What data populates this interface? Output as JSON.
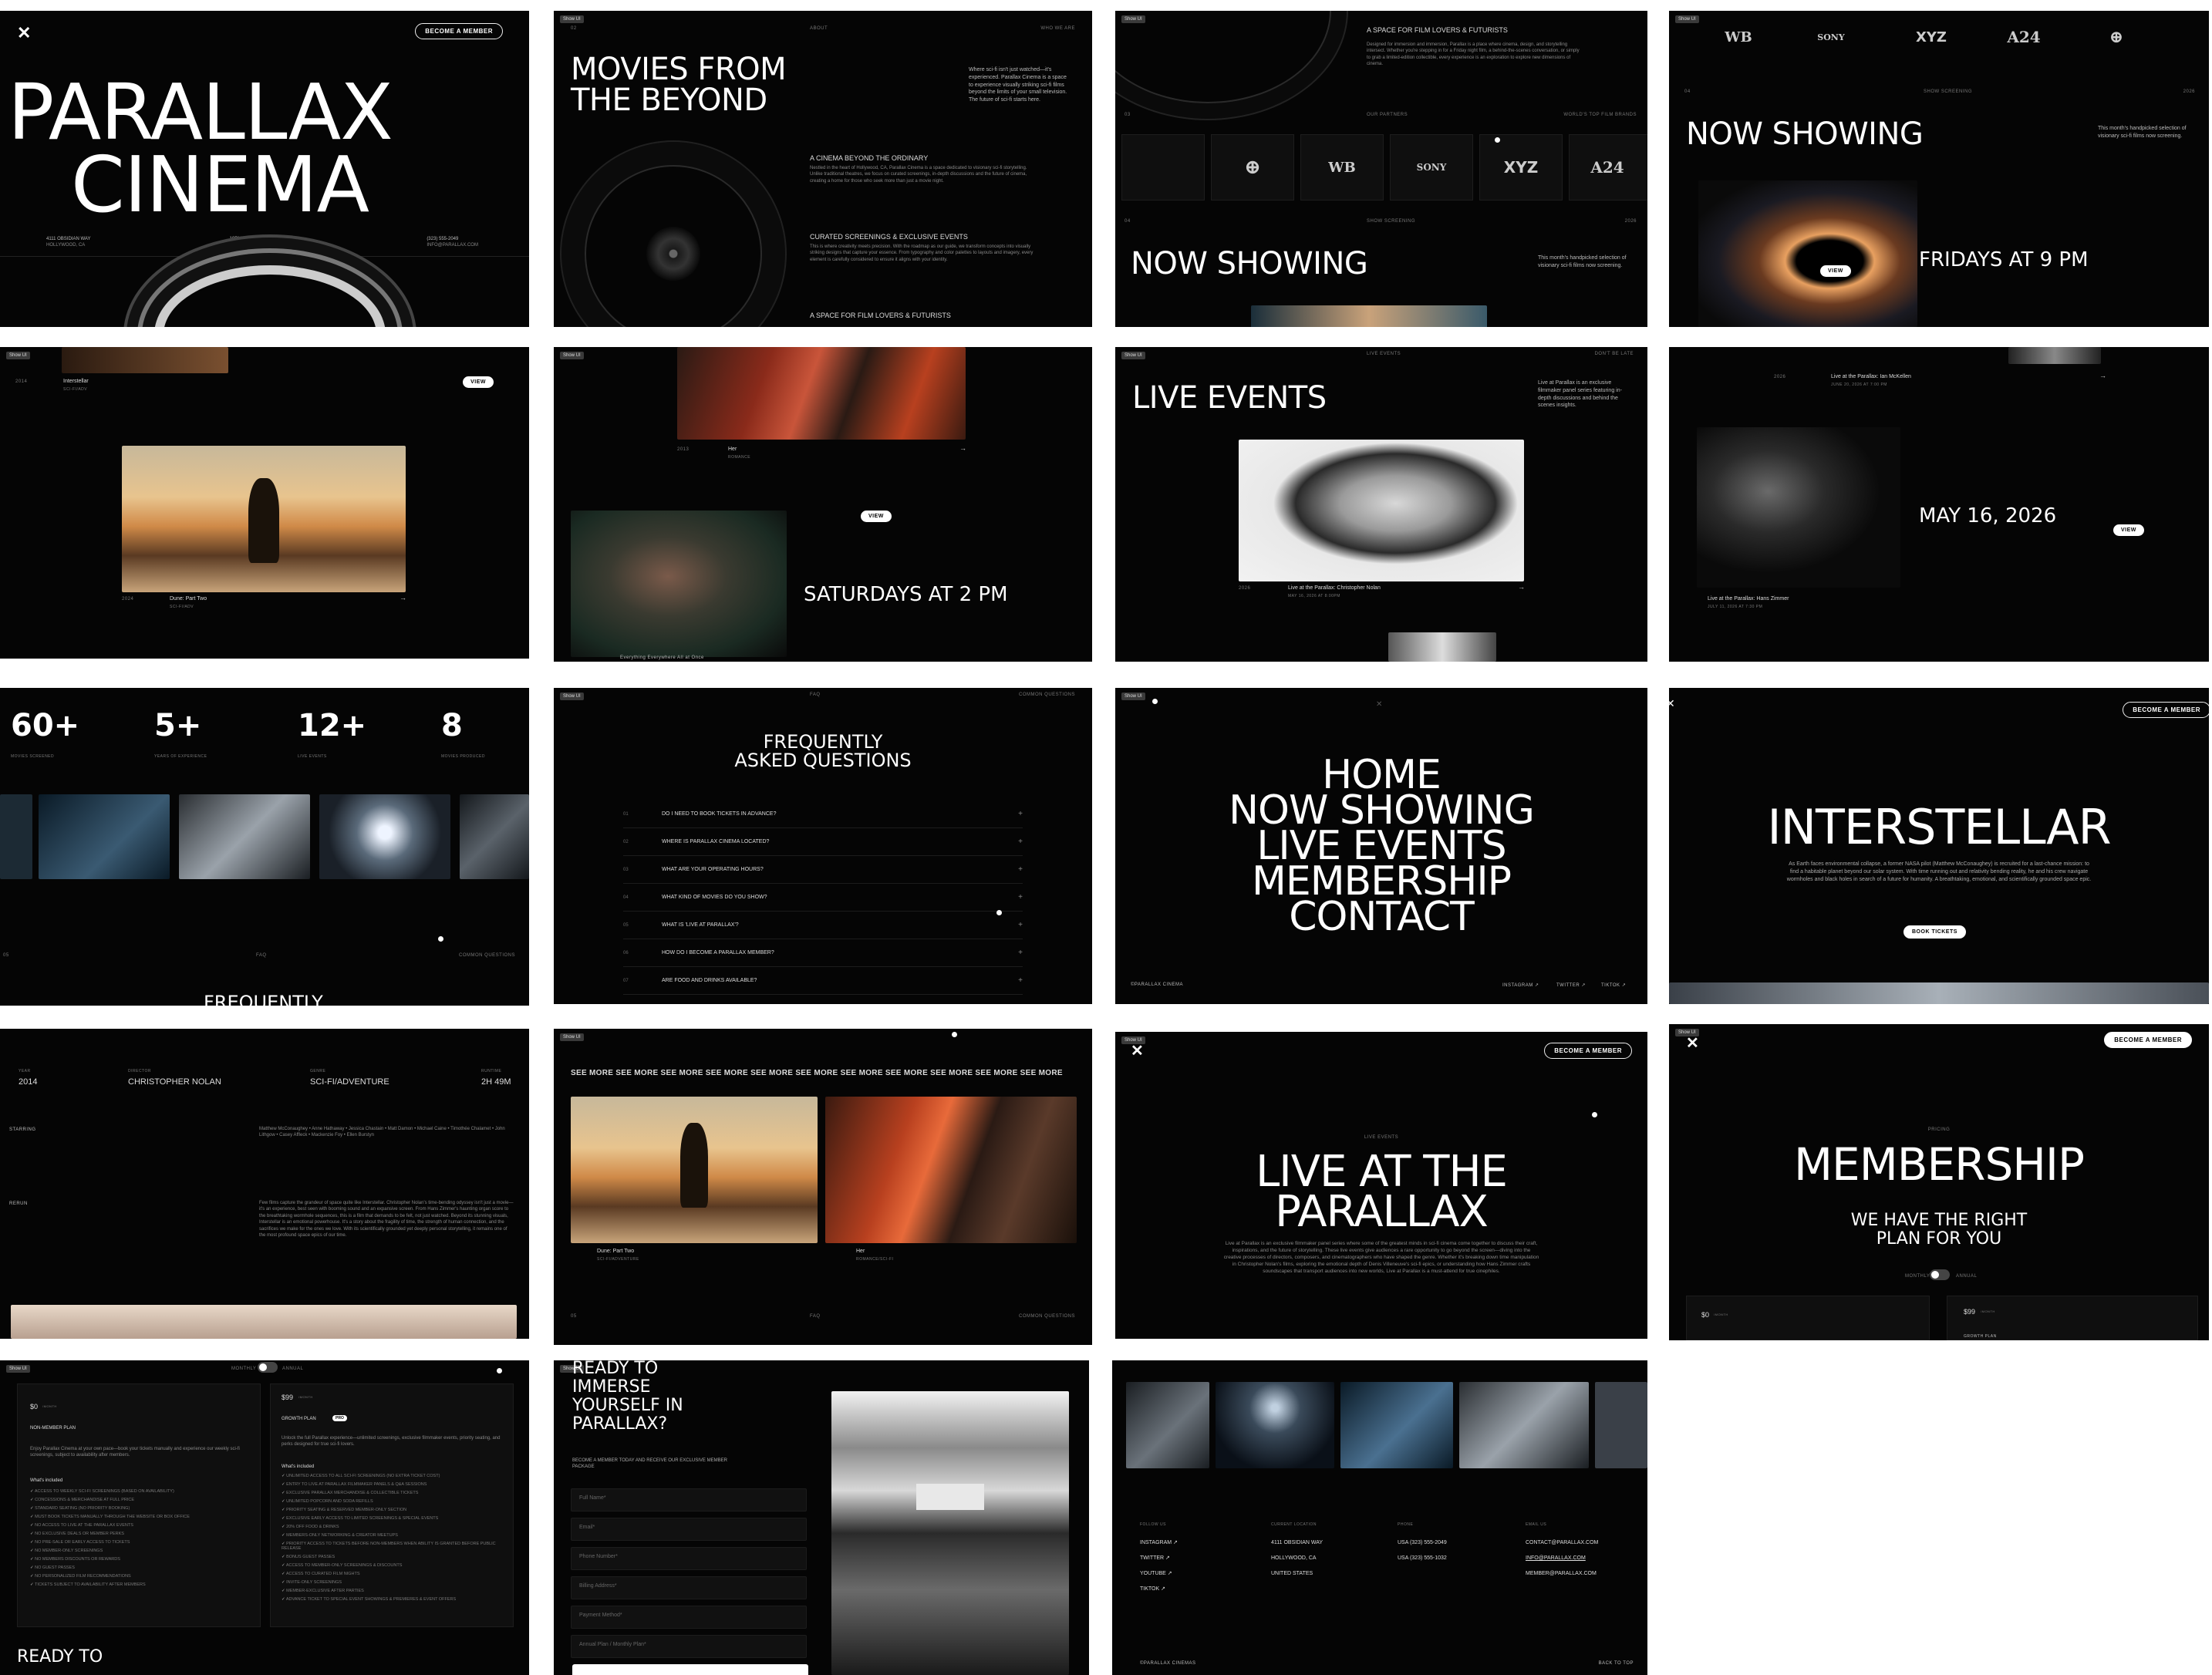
{
  "tag": "Show UI",
  "p1": {
    "cta": "BECOME A MEMBER",
    "title1": "PARALLAX",
    "title2": "CINEMA",
    "info": [
      {
        "a": "4111 OBSIDIAN WAY",
        "b": "HOLLYWOOD, CA"
      },
      {
        "a": "10PM TO 2AM",
        "b": "THURSDAY TO SATURDAY"
      },
      {
        "a": "(323) 555-2049",
        "b": "INFO@PARALLAX.COM"
      }
    ]
  },
  "p2": {
    "num": "02",
    "about": "ABOUT",
    "who": "WHO WE ARE",
    "title": "MOVIES FROM THE BEYOND",
    "intro": "Where sci-fi isn't just watched—it's experienced. Parallax Cinema is a space to experience visually striking sci-fi films beyond the limits of your small television. The future of sci-fi starts here.",
    "s1h": "A CINEMA BEYOND THE ORDINARY",
    "s1": "Nestled in the heart of Hollywood, CA, Parallax Cinema is a space dedicated to visionary sci-fi storytelling. Unlike traditional theatres, we focus on curated screenings, in-depth discussions and the future of cinema, creating a home for those who seek more than just a movie night.",
    "s2h": "CURATED SCREENINGS & EXCLUSIVE EVENTS",
    "s2": "This is where creativity meets precision. With the roadmap as our guide, we transform concepts into visually striking designs that capture your essence. From typography and color palettes to layouts and imagery, every element is carefully considered to ensure it aligns with your identity.",
    "s3h": "A SPACE FOR FILM LOVERS & FUTURISTS"
  },
  "p3": {
    "head": "A SPACE FOR FILM LOVERS & FUTURISTS",
    "body": "Designed for immersion and immersion, Parallax is a place where cinema, design, and storytelling intersect. Whether you're stepping in for a Friday night film, a behind-the-scenes conversation, or simply to grab a limited-edition collectible, every experience is an exploration to explore new dimensions of cinema.",
    "num": "03",
    "partners": "OUR PARTNERS",
    "brands": "WORLD'S TOP FILM BRANDS",
    "logos": [
      "⊕",
      "WB",
      "SONY",
      "XYZ",
      "A24"
    ],
    "num2": "04",
    "showing": "SHOW SCREENING",
    "year": "2026",
    "title": "NOW SHOWING",
    "desc": "This month's handpicked selection of visionary sci-fi films now screening."
  },
  "p4": {
    "logos": [
      "WB",
      "SONY",
      "XYZ",
      "A24",
      "⊕"
    ],
    "num": "04",
    "showing": "SHOW SCREENING",
    "year": "2026",
    "title": "NOW SHOWING",
    "desc": "This month's handpicked selection of visionary sci-fi films now screening.",
    "view": "VIEW",
    "time": "FRIDAYS AT 9 PM"
  },
  "p5": {
    "year": "2014",
    "film": "Interstellar",
    "sub": "SCI-FI/ADV",
    "view": "VIEW",
    "year2": "2024",
    "film2": "Dune: Part Two",
    "sub2": "SCI-FI/ADV"
  },
  "p6": {
    "year": "2013",
    "film": "Her",
    "sub": "ROMANCE",
    "view": "VIEW",
    "time": "SATURDAYS AT 2 PM",
    "film2": "Everything Everywhere All at Once"
  },
  "p7": {
    "title": "LIVE EVENTS",
    "label": "LIVE EVENTS",
    "label2": "DON'T BE LATE",
    "desc": "Live at Parallax is an exclusive filmmaker panel series featuring in-depth discussions and behind the scenes insights.",
    "year": "2026",
    "event": "Live at the Parallax: Christopher Nolan",
    "date": "MAY 16, 2026 AT 8:00PM"
  },
  "p8": {
    "year": "2026",
    "event": "Live at the Parallax: Ian McKellen",
    "edate": "JUNE 20, 2026 AT 7:00 PM",
    "date": "MAY 16, 2026",
    "view": "VIEW",
    "event2": "Live at the Parallax: Hans Zimmer",
    "edate2": "JULY 11, 2026 AT 7:30 PM"
  },
  "p9": {
    "stats": [
      {
        "v": "60+",
        "l": "MOVIES SCREENED"
      },
      {
        "v": "5+",
        "l": "YEARS OF EXPERIENCE"
      },
      {
        "v": "12+",
        "l": "LIVE EVENTS"
      },
      {
        "v": "8",
        "l": "MOVIES PRODUCED"
      }
    ],
    "num": "05",
    "faq": "FAQ",
    "cq": "COMMON QUESTIONS",
    "title": "FREQUENTLY"
  },
  "p10": {
    "faq": "FAQ",
    "cq": "COMMON QUESTIONS",
    "title1": "FREQUENTLY",
    "title2": "ASKED QUESTIONS",
    "items": [
      {
        "n": "01",
        "q": "DO I NEED TO BOOK TICKETS IN ADVANCE?"
      },
      {
        "n": "02",
        "q": "WHERE IS PARALLAX CINEMA LOCATED?"
      },
      {
        "n": "03",
        "q": "WHAT ARE YOUR OPERATING HOURS?"
      },
      {
        "n": "04",
        "q": "WHAT KIND OF MOVIES DO YOU SHOW?"
      },
      {
        "n": "05",
        "q": "WHAT IS 'LIVE AT PARALLAX'?"
      },
      {
        "n": "06",
        "q": "HOW DO I BECOME A PARALLAX MEMBER?"
      },
      {
        "n": "07",
        "q": "ARE FOOD AND DRINKS AVAILABLE?"
      }
    ],
    "plus": "+"
  },
  "p11": {
    "menu": [
      "HOME",
      "NOW SHOWING",
      "LIVE EVENTS",
      "MEMBERSHIP",
      "CONTACT"
    ],
    "brand": "©PARALLAX CINEMA",
    "social": [
      "INSTAGRAM ↗",
      "TWITTER ↗",
      "TIKTOK ↗"
    ]
  },
  "p12": {
    "cta": "BECOME A MEMBER",
    "title": "INTERSTELLAR",
    "desc": "As Earth faces environmental collapse, a former NASA pilot (Matthew McConaughey) is recruited for a last-chance mission: to find a habitable planet beyond our solar system. With time running out and relativity bending reality, he and his crew navigate wormholes and black holes in search of a future for humanity. A breathtaking, emotional, and scientifically grounded space epic.",
    "book": "BOOK TICKETS"
  },
  "p13": {
    "cols": [
      {
        "l": "YEAR",
        "v": "2014"
      },
      {
        "l": "DIRECTOR",
        "v": "CHRISTOPHER NOLAN"
      },
      {
        "l": "GENRE",
        "v": "SCI-FI/ADVENTURE"
      },
      {
        "l": "RUNTIME",
        "v": "2H 49M"
      }
    ],
    "starring": "STARRING",
    "cast": "Matthew McConaughey • Anne Hathaway • Jessica Chastain • Matt Damon • Michael Caine • Timothée Chalamet • John Lithgow • Casey Affleck • Mackenzie Foy • Ellen Burstyn",
    "rerun": "RERUN",
    "review": "Few films capture the grandeur of space quite like Interstellar. Christopher Nolan's time-bending odyssey isn't just a movie—it's an experience, best seen with booming sound and an expansive screen. From Hans Zimmer's haunting organ score to the breathtaking wormhole sequences, this is a film that demands to be felt, not just watched. Beyond its stunning visuals, Interstellar is an emotional powerhouse. It's a story about the fragility of time, the strength of human connection, and the sacrifices we make for the ones we love. With its scientifically grounded yet deeply personal storytelling, it remains one of the most profound space epics of our time."
  },
  "p14": {
    "marquee": "SEE MORE  SEE MORE  SEE MORE  SEE MORE  SEE MORE  SEE MORE  SEE MORE  SEE MORE  SEE MORE  SEE MORE  SEE MORE",
    "film1": "Dune: Part Two",
    "sub1": "SCI-FI/ADVENTURE",
    "film2": "Her",
    "sub2": "ROMANCE/SCI-FI",
    "num": "05",
    "faq": "FAQ",
    "cq": "COMMON QUESTIONS"
  },
  "p15": {
    "cta": "BECOME A MEMBER",
    "label": "LIVE EVENTS",
    "title1": "LIVE AT THE",
    "title2": "PARALLAX",
    "desc": "Live at Parallax is an exclusive filmmaker panel series where some of the greatest minds in sci-fi cinema come together to discuss their craft, inspirations, and the future of storytelling. These live events give audiences a rare opportunity to go beyond the screen—diving into the creative processes of directors, composers, and cinematographers who have shaped the genre. Whether it's breaking down time manipulation in Christopher Nolan's films, exploring the emotional depth of Denis Villeneuve's sci-fi epics, or understanding how Hans Zimmer crafts soundscapes that transport audiences into new worlds, Live at Parallax is a must-attend for true cinephiles."
  },
  "p16": {
    "cta": "BECOME A MEMBER",
    "label": "PRICING",
    "title": "MEMBERSHIP",
    "sub1": "WE HAVE THE RIGHT",
    "sub2": "PLAN FOR YOU",
    "monthly": "MONTHLY",
    "annual": "ANNUAL",
    "p1": "$0",
    "p1u": "/MONTH",
    "p2": "$99",
    "p2u": "/MONTH",
    "growth": "GROWTH PLAN"
  },
  "p17": {
    "monthly": "MONTHLY",
    "annual": "ANNUAL",
    "free": {
      "price": "$0",
      "unit": "/MONTH",
      "name": "NON-MEMBER PLAN",
      "desc": "Enjoy Parallax Cinema at your own pace—book your tickets manually and experience our weekly sci-fi screenings, subject to availability after members.",
      "inc": "What's included",
      "items": [
        "ACCESS TO WEEKLY SCI-FI SCREENINGS (BASED ON AVAILABILITY)",
        "CONCESSIONS & MERCHANDISE AT FULL PRICE",
        "STANDARD SEATING (NO PRIORITY BOOKING)",
        "MUST BOOK TICKETS MANUALLY THROUGH THE WEBSITE OR BOX OFFICE",
        "NO ACCESS TO LIVE AT THE PARALLAX EVENTS",
        "NO EXCLUSIVE DEALS OR MEMBER PERKS",
        "NO PRE-SALE OR EARLY ACCESS TO TICKETS",
        "NO MEMBER-ONLY SCREENINGS",
        "NO MEMBERS DISCOUNTS OR REWARDS",
        "NO GUEST PASSES",
        "NO PERSONALIZED FILM RECOMMENDATIONS",
        "TICKETS SUBJECT TO AVAILABILITY AFTER MEMBERS"
      ]
    },
    "pro": {
      "price": "$99",
      "unit": "/MONTH",
      "name": "GROWTH PLAN",
      "badge": "PRO",
      "desc": "Unlock the full Parallax experience—unlimited screenings, exclusive filmmaker events, priority seating, and perks designed for true sci-fi lovers.",
      "inc": "What's included",
      "items": [
        "UNLIMITED ACCESS TO ALL SCI-FI SCREENINGS (NO EXTRA TICKET COST)",
        "ENTRY TO LIVE AT PARALLAX FILMMAKER PANELS & Q&A SESSIONS",
        "EXCLUSIVE PARALLAX MERCHANDISE & COLLECTIBLE TICKETS",
        "UNLIMITED POPCORN AND SODA REFILLS",
        "PRIORITY SEATING & RESERVED MEMBER-ONLY SECTION",
        "EXCLUSIVE EARLY ACCESS TO LIMITED SCREENINGS & SPECIAL EVENTS",
        "20% OFF FOOD & DRINKS",
        "MEMBERS-ONLY NETWORKING & CREATOR MEETUPS",
        "PRIORITY ACCESS TO TICKETS BEFORE NON-MEMBERS WHEN ABILITY IS GRANTED BEFORE PUBLIC RELEASE",
        "BONUS GUEST PASSES",
        "ACCESS TO MEMBER-ONLY SCREENINGS & DISCOUNTS",
        "ACCESS TO CURATED FILM NIGHTS",
        "INVITE-ONLY SCREENINGS",
        "MEMBER-EXCLUSIVE AFTER PARTIES",
        "ADVANCE TICKET TO SPECIAL EVENT SHOWINGS & PREMIERES & EVENT OFFERS"
      ]
    },
    "ready": "READY TO"
  },
  "p18": {
    "title": [
      "READY TO",
      "IMMERSE",
      "YOURSELF IN",
      "PARALLAX?"
    ],
    "desc": "BECOME A MEMBER TODAY AND RECEIVE OUR EXCLUSIVE MEMBER PACKAGE",
    "fields": [
      "Full Name*",
      "Email*",
      "Phone Number*",
      "Billing Address*",
      "Payment Method*",
      "Annual Plan / Monthly Plan*"
    ]
  },
  "p19": {
    "cols": [
      {
        "h": "FOLLOW US",
        "items": [
          "INSTAGRAM ↗",
          "TWITTER ↗",
          "YOUTUBE ↗",
          "TIKTOK ↗"
        ]
      },
      {
        "h": "CURRENT LOCATION",
        "items": [
          "4111 OBSIDIAN WAY",
          "HOLLYWOOD, CA",
          "UNITED STATES"
        ]
      },
      {
        "h": "PHONE",
        "items": [
          "USA  (323) 555-2049",
          "USA  (323) 555-1032"
        ]
      },
      {
        "h": "EMAIL US",
        "items": [
          "CONTACT@PARALLAX.COM",
          "INFO@PARALLAX.COM",
          "MEMBER@PARALLAX.COM"
        ]
      }
    ],
    "copy": "©PARALLAX CINEMAS",
    "top": "BACK TO TOP"
  }
}
